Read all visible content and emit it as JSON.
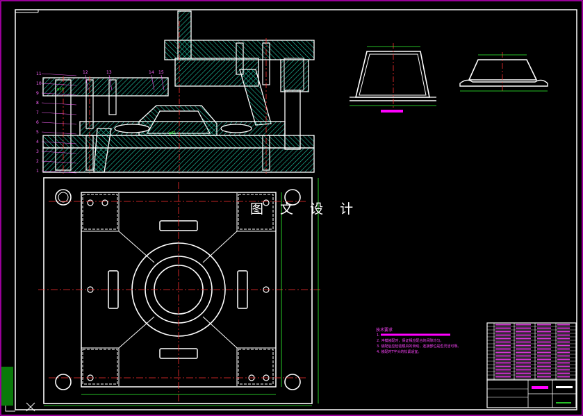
{
  "watermark": "图 文 设 计",
  "colors": {
    "background": "#000000",
    "outline": "#ffffff",
    "border": "#cc00cc",
    "centerline": "#ff3030",
    "hatch": "#22c9a8",
    "leader": "#ff66ff",
    "dimension": "#33ff33",
    "tech": "#ff44ff",
    "highlight": "#ff00ff"
  },
  "part_numbers_left": [
    "11",
    "10",
    "9",
    "8",
    "7",
    "6",
    "5",
    "4",
    "3",
    "2",
    "1"
  ],
  "part_numbers_top": [
    "12",
    "13",
    "14",
    "15"
  ],
  "tech_requirements": {
    "title": "技术要求",
    "items": [
      "1.",
      "2. 冲模装配时，保证相应配合的间隙均匀。",
      "3. 装配后应检验模具的滑动，连接部位是否灵活可靠。",
      "4. 装配时T字头的松紧适宜。"
    ]
  },
  "icons": [
    "ucs-axis-icon",
    "cross-marker-icon"
  ]
}
